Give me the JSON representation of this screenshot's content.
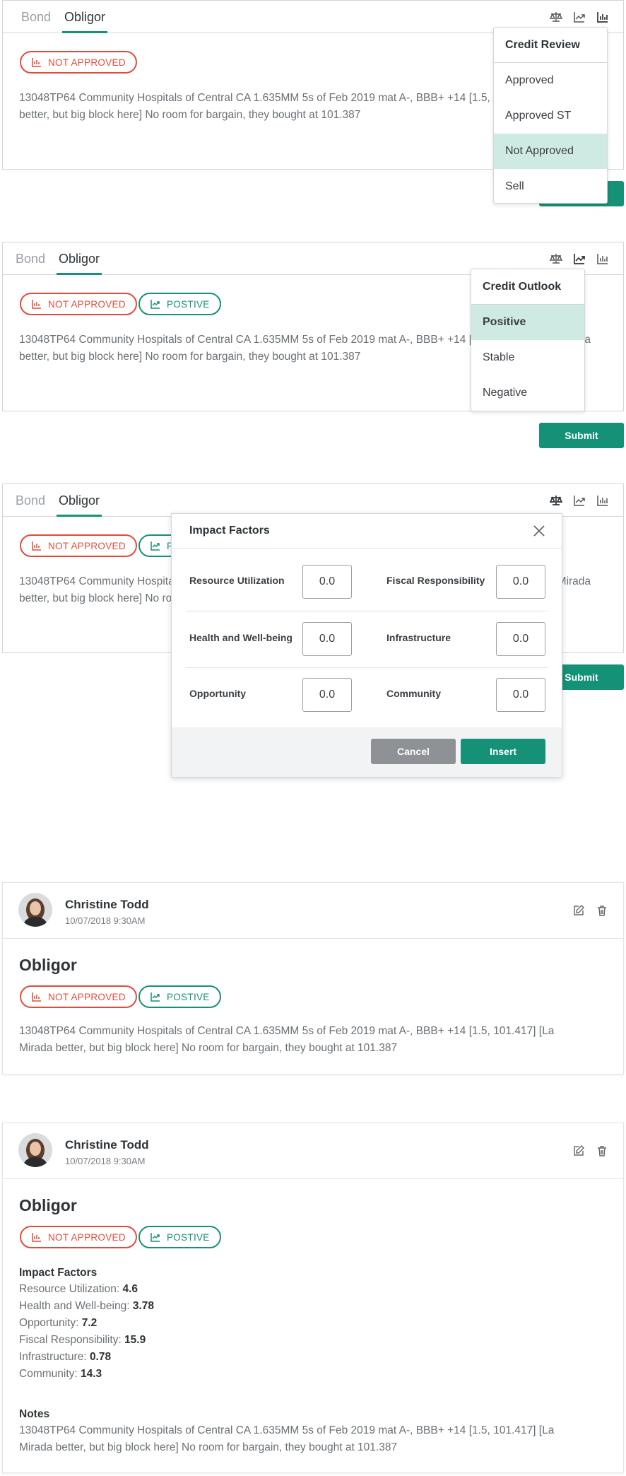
{
  "tabs": {
    "bond": "Bond",
    "obligor": "Obligor"
  },
  "badges": {
    "not_approved": "NOT APPROVED",
    "positive": "POSTIVE"
  },
  "note_text": "13048TP64 Community Hospitals of Central CA 1.635MM 5s of Feb 2019 mat A-, BBB+ +14 [1.5, 101.417] [La Mirada better, but big block here] No room for bargain, they bought at 101.387",
  "submit_label": "Submit",
  "credit_review_menu": {
    "header": "Credit Review",
    "items": [
      "Approved",
      "Approved ST",
      "Not Approved",
      "Sell"
    ],
    "selected": "Not Approved"
  },
  "credit_outlook_menu": {
    "header": "Credit Outlook",
    "items": [
      "Positive",
      "Stable",
      "Negative"
    ],
    "selected": "Positive"
  },
  "impact_modal": {
    "title": "Impact Factors",
    "fields": [
      {
        "label": "Resource Utilization",
        "value": "0.0"
      },
      {
        "label": "Fiscal Responsibility",
        "value": "0.0"
      },
      {
        "label": "Health and Well-being",
        "value": "0.0"
      },
      {
        "label": "Infrastructure",
        "value": "0.0"
      },
      {
        "label": "Opportunity",
        "value": "0.0"
      },
      {
        "label": "Community",
        "value": "0.0"
      }
    ],
    "cancel_label": "Cancel",
    "insert_label": "Insert"
  },
  "comment": {
    "author": "Christine Todd",
    "date": "10/07/2018 9:30AM",
    "title": "Obligor"
  },
  "impact_summary": {
    "heading": "Impact Factors",
    "items": [
      {
        "label": "Resource Utilization:",
        "value": "4.6"
      },
      {
        "label": "Health and Well-being:",
        "value": "3.78"
      },
      {
        "label": "Opportunity:",
        "value": "7.2"
      },
      {
        "label": "Fiscal Responsibility:",
        "value": "15.9"
      },
      {
        "label": "Infrastructure:",
        "value": "0.78"
      },
      {
        "label": "Community:",
        "value": "14.3"
      }
    ],
    "notes_heading": "Notes"
  },
  "colors": {
    "accent": "#149177",
    "danger": "#e14b3c",
    "selected_bg": "#cfeae2"
  },
  "icons": [
    "scale-icon",
    "trending-up-icon",
    "bar-chart-icon",
    "close-icon",
    "edit-icon",
    "trash-icon",
    "avatar"
  ]
}
